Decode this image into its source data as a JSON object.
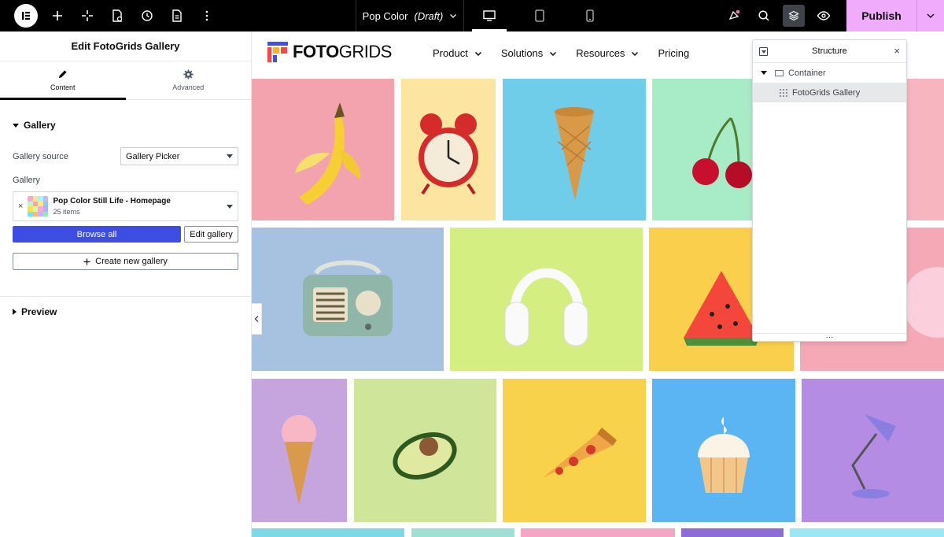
{
  "topbar": {
    "doc_title": "Pop Color",
    "doc_status": "(Draft)",
    "publish_label": "Publish"
  },
  "panel": {
    "header": "Edit FotoGrids Gallery",
    "tabs": [
      {
        "label": "Content"
      },
      {
        "label": "Advanced"
      }
    ],
    "gallery_section": "Gallery",
    "source_label": "Gallery source",
    "source_value": "Gallery Picker",
    "gallery_label": "Gallery",
    "gallery_card": {
      "title": "Pop Color Still Life - Homepage",
      "count": "25 items",
      "remove": "×"
    },
    "browse_label": "Browse all",
    "edit_label": "Edit gallery",
    "create_label": "Create new gallery",
    "preview_section": "Preview"
  },
  "site": {
    "logo": {
      "bold": "FOTO",
      "light": "GRIDS"
    },
    "nav": [
      {
        "label": "Product",
        "dropdown": true
      },
      {
        "label": "Solutions",
        "dropdown": true
      },
      {
        "label": "Resources",
        "dropdown": true
      },
      {
        "label": "Pricing",
        "dropdown": false
      }
    ]
  },
  "structure": {
    "title": "Structure",
    "items": [
      {
        "label": "Container"
      },
      {
        "label": "FotoGrids Gallery"
      }
    ]
  },
  "gallery_tiles": [
    {
      "name": "banana",
      "bg": "#f3a3ad"
    },
    {
      "name": "alarm-clock",
      "bg": "#fbe5a0"
    },
    {
      "name": "ice-cream-cone",
      "bg": "#6fcde9"
    },
    {
      "name": "cherries",
      "bg": "#a7ecc6"
    },
    {
      "name": "pink-item",
      "bg": "#f6b5bf"
    },
    {
      "name": "retro-radio",
      "bg": "#a6c2e0"
    },
    {
      "name": "headphones",
      "bg": "#d5ee82"
    },
    {
      "name": "watermelon",
      "bg": "#f9cf4b"
    },
    {
      "name": "donut",
      "bg": "#f5a9b6"
    },
    {
      "name": "ice-cream",
      "bg": "#c6a4de"
    },
    {
      "name": "avocado",
      "bg": "#cfe69a"
    },
    {
      "name": "pizza-slice",
      "bg": "#f7d24a"
    },
    {
      "name": "cupcake",
      "bg": "#5ab5f2"
    },
    {
      "name": "desk-lamp",
      "bg": "#b48ce4"
    },
    {
      "name": "row4-a",
      "bg": "#7fd8e6"
    },
    {
      "name": "row4-b",
      "bg": "#9fe0d4"
    },
    {
      "name": "row4-c",
      "bg": "#f4a6c4"
    },
    {
      "name": "row4-d",
      "bg": "#8d6cd6"
    },
    {
      "name": "row4-e",
      "bg": "#9be7f2"
    }
  ]
}
